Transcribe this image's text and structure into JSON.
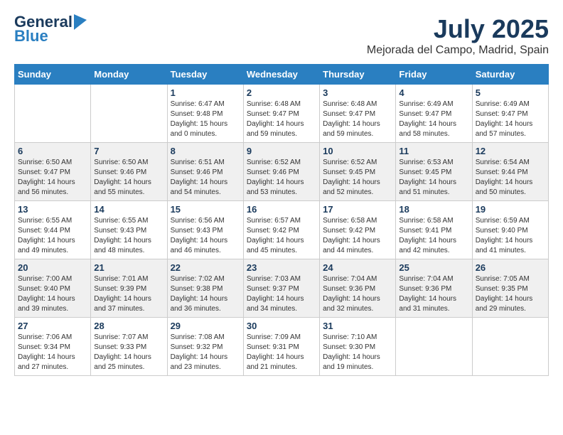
{
  "logo": {
    "general": "General",
    "blue": "Blue"
  },
  "title": "July 2025",
  "subtitle": "Mejorada del Campo, Madrid, Spain",
  "weekdays": [
    "Sunday",
    "Monday",
    "Tuesday",
    "Wednesday",
    "Thursday",
    "Friday",
    "Saturday"
  ],
  "weeks": [
    [
      {
        "day": "",
        "detail": ""
      },
      {
        "day": "",
        "detail": ""
      },
      {
        "day": "1",
        "detail": "Sunrise: 6:47 AM\nSunset: 9:48 PM\nDaylight: 15 hours\nand 0 minutes."
      },
      {
        "day": "2",
        "detail": "Sunrise: 6:48 AM\nSunset: 9:47 PM\nDaylight: 14 hours\nand 59 minutes."
      },
      {
        "day": "3",
        "detail": "Sunrise: 6:48 AM\nSunset: 9:47 PM\nDaylight: 14 hours\nand 59 minutes."
      },
      {
        "day": "4",
        "detail": "Sunrise: 6:49 AM\nSunset: 9:47 PM\nDaylight: 14 hours\nand 58 minutes."
      },
      {
        "day": "5",
        "detail": "Sunrise: 6:49 AM\nSunset: 9:47 PM\nDaylight: 14 hours\nand 57 minutes."
      }
    ],
    [
      {
        "day": "6",
        "detail": "Sunrise: 6:50 AM\nSunset: 9:47 PM\nDaylight: 14 hours\nand 56 minutes."
      },
      {
        "day": "7",
        "detail": "Sunrise: 6:50 AM\nSunset: 9:46 PM\nDaylight: 14 hours\nand 55 minutes."
      },
      {
        "day": "8",
        "detail": "Sunrise: 6:51 AM\nSunset: 9:46 PM\nDaylight: 14 hours\nand 54 minutes."
      },
      {
        "day": "9",
        "detail": "Sunrise: 6:52 AM\nSunset: 9:46 PM\nDaylight: 14 hours\nand 53 minutes."
      },
      {
        "day": "10",
        "detail": "Sunrise: 6:52 AM\nSunset: 9:45 PM\nDaylight: 14 hours\nand 52 minutes."
      },
      {
        "day": "11",
        "detail": "Sunrise: 6:53 AM\nSunset: 9:45 PM\nDaylight: 14 hours\nand 51 minutes."
      },
      {
        "day": "12",
        "detail": "Sunrise: 6:54 AM\nSunset: 9:44 PM\nDaylight: 14 hours\nand 50 minutes."
      }
    ],
    [
      {
        "day": "13",
        "detail": "Sunrise: 6:55 AM\nSunset: 9:44 PM\nDaylight: 14 hours\nand 49 minutes."
      },
      {
        "day": "14",
        "detail": "Sunrise: 6:55 AM\nSunset: 9:43 PM\nDaylight: 14 hours\nand 48 minutes."
      },
      {
        "day": "15",
        "detail": "Sunrise: 6:56 AM\nSunset: 9:43 PM\nDaylight: 14 hours\nand 46 minutes."
      },
      {
        "day": "16",
        "detail": "Sunrise: 6:57 AM\nSunset: 9:42 PM\nDaylight: 14 hours\nand 45 minutes."
      },
      {
        "day": "17",
        "detail": "Sunrise: 6:58 AM\nSunset: 9:42 PM\nDaylight: 14 hours\nand 44 minutes."
      },
      {
        "day": "18",
        "detail": "Sunrise: 6:58 AM\nSunset: 9:41 PM\nDaylight: 14 hours\nand 42 minutes."
      },
      {
        "day": "19",
        "detail": "Sunrise: 6:59 AM\nSunset: 9:40 PM\nDaylight: 14 hours\nand 41 minutes."
      }
    ],
    [
      {
        "day": "20",
        "detail": "Sunrise: 7:00 AM\nSunset: 9:40 PM\nDaylight: 14 hours\nand 39 minutes."
      },
      {
        "day": "21",
        "detail": "Sunrise: 7:01 AM\nSunset: 9:39 PM\nDaylight: 14 hours\nand 37 minutes."
      },
      {
        "day": "22",
        "detail": "Sunrise: 7:02 AM\nSunset: 9:38 PM\nDaylight: 14 hours\nand 36 minutes."
      },
      {
        "day": "23",
        "detail": "Sunrise: 7:03 AM\nSunset: 9:37 PM\nDaylight: 14 hours\nand 34 minutes."
      },
      {
        "day": "24",
        "detail": "Sunrise: 7:04 AM\nSunset: 9:36 PM\nDaylight: 14 hours\nand 32 minutes."
      },
      {
        "day": "25",
        "detail": "Sunrise: 7:04 AM\nSunset: 9:36 PM\nDaylight: 14 hours\nand 31 minutes."
      },
      {
        "day": "26",
        "detail": "Sunrise: 7:05 AM\nSunset: 9:35 PM\nDaylight: 14 hours\nand 29 minutes."
      }
    ],
    [
      {
        "day": "27",
        "detail": "Sunrise: 7:06 AM\nSunset: 9:34 PM\nDaylight: 14 hours\nand 27 minutes."
      },
      {
        "day": "28",
        "detail": "Sunrise: 7:07 AM\nSunset: 9:33 PM\nDaylight: 14 hours\nand 25 minutes."
      },
      {
        "day": "29",
        "detail": "Sunrise: 7:08 AM\nSunset: 9:32 PM\nDaylight: 14 hours\nand 23 minutes."
      },
      {
        "day": "30",
        "detail": "Sunrise: 7:09 AM\nSunset: 9:31 PM\nDaylight: 14 hours\nand 21 minutes."
      },
      {
        "day": "31",
        "detail": "Sunrise: 7:10 AM\nSunset: 9:30 PM\nDaylight: 14 hours\nand 19 minutes."
      },
      {
        "day": "",
        "detail": ""
      },
      {
        "day": "",
        "detail": ""
      }
    ]
  ]
}
